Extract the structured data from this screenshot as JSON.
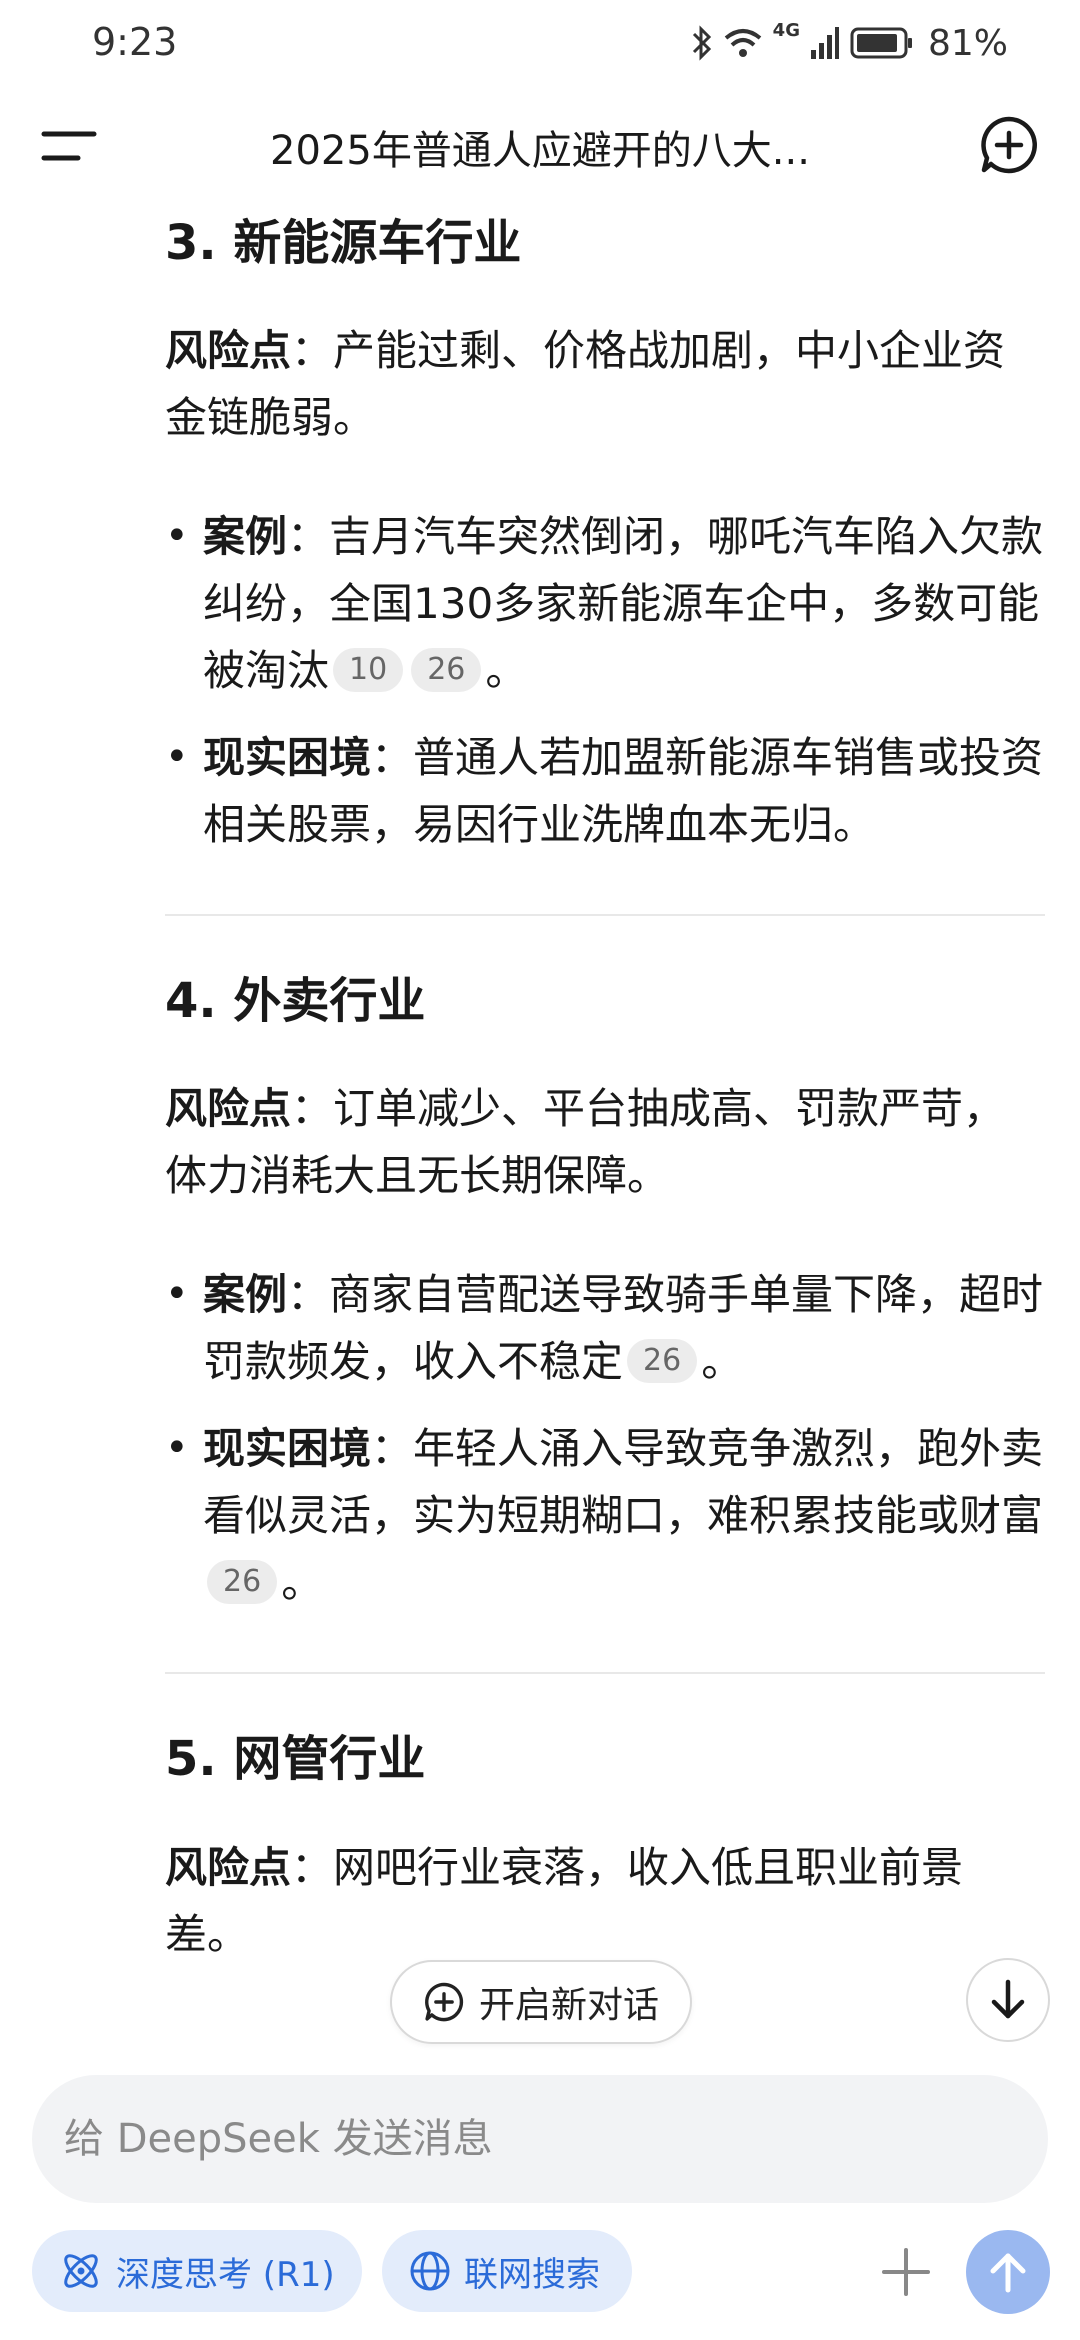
{
  "status": {
    "time": "9:23",
    "network": "4G",
    "battery": "81%"
  },
  "header": {
    "title": "2025年普通人应避开的八大..."
  },
  "sections": [
    {
      "title": "3. 新能源车行业",
      "risk_label": "风险点",
      "risk_text": "：产能过剩、价格战加剧，中小企业资金链脆弱。",
      "case_label": "案例",
      "case_text": "：吉月汽车突然倒闭，哪吒汽车陷入欠款纠纷，全国130多家新能源车企中，多数可能被淘汰",
      "case_cites": [
        "10",
        "26"
      ],
      "case_end": "。",
      "dilemma_label": "现实困境",
      "dilemma_text": "：普通人若加盟新能源车销售或投资相关股票，易因行业洗牌血本无归。"
    },
    {
      "title": "4. 外卖行业",
      "risk_label": "风险点",
      "risk_text": "：订单减少、平台抽成高、罚款严苛，体力消耗大且无长期保障。",
      "case_label": "案例",
      "case_text": "：商家自营配送导致骑手单量下降，超时罚款频发，收入不稳定",
      "case_cites": [
        "26"
      ],
      "case_end": "。",
      "dilemma_label": "现实困境",
      "dilemma_text": "：年轻人涌入导致竞争激烈，跑外卖看似灵活，实为短期糊口，难积累技能或财富",
      "dilemma_cites": [
        "26"
      ],
      "dilemma_end": "。"
    },
    {
      "title": "5. 网管行业",
      "risk_label": "风险点",
      "risk_text": "：网吧行业衰落，收入低且职业前景差。"
    }
  ],
  "floating": {
    "new_chat_label": "开启新对话"
  },
  "input": {
    "placeholder": "给 DeepSeek 发送消息"
  },
  "toolbar": {
    "deep_think_label": "深度思考 (R1)",
    "web_search_label": "联网搜索"
  },
  "colors": {
    "accent": "#2b6bd8",
    "chip_bg": "#e3ecfb",
    "send_disabled": "#9ab8f0"
  }
}
